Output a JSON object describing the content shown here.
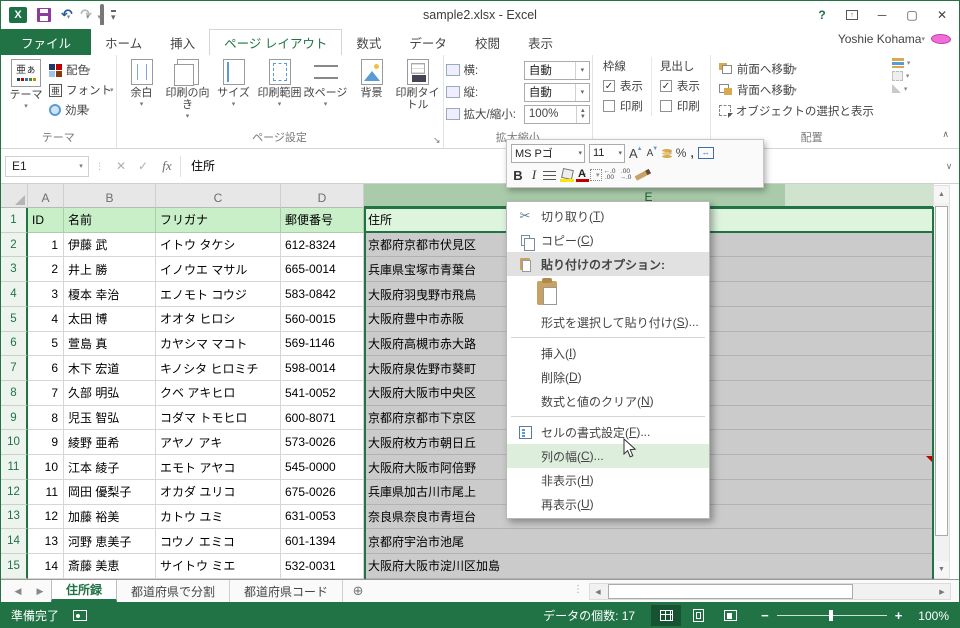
{
  "colors": {
    "accent": "#217346",
    "header_fill": "#c9efc9",
    "selection_grey": "#cbcbcb",
    "selected_col_header": "#a9cba9",
    "comment_red": "#c00000",
    "status_bar": "#217346"
  },
  "titlebar": {
    "title": "sample2.xlsx - Excel",
    "user": "Yoshie Kohama",
    "help": "?"
  },
  "ribbon_tabs": {
    "file": "ファイル",
    "items": [
      "ホーム",
      "挿入",
      "ページ レイアウト",
      "数式",
      "データ",
      "校閲",
      "表示"
    ],
    "active": "ページ レイアウト"
  },
  "ribbon": {
    "themes": {
      "main": "テーマ",
      "glyph": "亜ぁ",
      "glyph_small": "亜",
      "color": "配色",
      "font": "フォント",
      "effect": "効果",
      "label": "テーマ"
    },
    "page_setup": {
      "buttons": [
        "余白",
        "印刷の向き",
        "サイズ",
        "印刷範囲",
        "改ページ",
        "背景",
        "印刷タイトル"
      ],
      "label": "ページ設定"
    },
    "scale": {
      "width_label": "横:",
      "width_value": "自動",
      "height_label": "縦:",
      "height_value": "自動",
      "zoom_label": "拡大/縮小:",
      "zoom_value": "100%",
      "label": "拡大縮小"
    },
    "sheet_options": {
      "gridlines": "枠線",
      "headings": "見出し",
      "view": "表示",
      "print": "印刷"
    },
    "arrange": {
      "bring_front": "前面へ移動",
      "send_back": "背面へ移動",
      "selection_pane": "オブジェクトの選択と表示",
      "label": "配置"
    }
  },
  "mini_toolbar": {
    "font": "MS Pゴ",
    "size": "11",
    "bold": "B",
    "italic": "I",
    "percent": "%",
    "comma": ","
  },
  "formula_bar": {
    "name_box": "E1",
    "value": "住所",
    "fx": "fx"
  },
  "grid": {
    "col_letters": [
      "A",
      "B",
      "C",
      "D",
      "E"
    ],
    "header_row": {
      "n": "1",
      "id": "ID",
      "name": "名前",
      "kana": "フリガナ",
      "zip": "郵便番号",
      "addr": "住所"
    },
    "rows": [
      {
        "n": "2",
        "id": "1",
        "name": "伊藤 武",
        "kana": "イトウ タケシ",
        "zip": "612-8324",
        "addr": "京都府京都市伏見区"
      },
      {
        "n": "3",
        "id": "2",
        "name": "井上 勝",
        "kana": "イノウエ マサル",
        "zip": "665-0014",
        "addr": "兵庫県宝塚市青葉台"
      },
      {
        "n": "4",
        "id": "3",
        "name": "榎本 幸治",
        "kana": "エノモト コウジ",
        "zip": "583-0842",
        "addr": "大阪府羽曳野市飛鳥"
      },
      {
        "n": "5",
        "id": "4",
        "name": "太田 博",
        "kana": "オオタ ヒロシ",
        "zip": "560-0015",
        "addr": "大阪府豊中市赤阪"
      },
      {
        "n": "6",
        "id": "5",
        "name": "萱島 真",
        "kana": "カヤシマ マコト",
        "zip": "569-1146",
        "addr": "大阪府高槻市赤大路"
      },
      {
        "n": "7",
        "id": "6",
        "name": "木下 宏道",
        "kana": "キノシタ ヒロミチ",
        "zip": "598-0014",
        "addr": "大阪府泉佐野市葵町"
      },
      {
        "n": "8",
        "id": "7",
        "name": "久部 明弘",
        "kana": "クベ アキヒロ",
        "zip": "541-0052",
        "addr": "大阪府大阪市中央区"
      },
      {
        "n": "9",
        "id": "8",
        "name": "児玉 智弘",
        "kana": "コダマ トモヒロ",
        "zip": "600-8071",
        "addr": "京都府京都市下京区"
      },
      {
        "n": "10",
        "id": "9",
        "name": "綾野 亜希",
        "kana": "アヤノ アキ",
        "zip": "573-0026",
        "addr": "大阪府枚方市朝日丘"
      },
      {
        "n": "11",
        "id": "10",
        "name": "江本 綾子",
        "kana": "エモト アヤコ",
        "zip": "545-0000",
        "addr": "大阪府大阪市阿倍野",
        "flags": [
          "has-comment"
        ]
      },
      {
        "n": "12",
        "id": "11",
        "name": "岡田 優梨子",
        "kana": "オカダ ユリコ",
        "zip": "675-0026",
        "addr": "兵庫県加古川市尾上"
      },
      {
        "n": "13",
        "id": "12",
        "name": "加藤 裕美",
        "kana": "カトウ ユミ",
        "zip": "631-0053",
        "addr": "奈良県奈良市青垣台"
      },
      {
        "n": "14",
        "id": "13",
        "name": "河野 恵美子",
        "kana": "コウノ エミコ",
        "zip": "601-1394",
        "addr": "京都府宇治市池尾"
      },
      {
        "n": "15",
        "id": "14",
        "name": "斎藤 美恵",
        "kana": "サイトウ ミエ",
        "zip": "532-0031",
        "addr": "大阪府大阪市淀川区加島"
      }
    ]
  },
  "context_menu": {
    "items": {
      "cut": {
        "pre": "切り取り(",
        "key": "T",
        "post": ")"
      },
      "copy": {
        "pre": "コピー(",
        "key": "C",
        "post": ")"
      },
      "paste_options": {
        "pre": "貼り付けのオプション:",
        "key": "",
        "post": ""
      },
      "paste_special": {
        "pre": "形式を選択して貼り付け(",
        "key": "S",
        "post": ")..."
      },
      "insert": {
        "pre": "挿入(",
        "key": "I",
        "post": ")"
      },
      "delete": {
        "pre": "削除(",
        "key": "D",
        "post": ")"
      },
      "clear": {
        "pre": "数式と値のクリア(",
        "key": "N",
        "post": ")"
      },
      "format_cells": {
        "pre": "セルの書式設定(",
        "key": "F",
        "post": ")..."
      },
      "column_width": {
        "pre": "列の幅(",
        "key": "C",
        "post": ")..."
      },
      "hide": {
        "pre": "非表示(",
        "key": "H",
        "post": ")"
      },
      "unhide": {
        "pre": "再表示(",
        "key": "U",
        "post": ")"
      }
    }
  },
  "sheet_tabs": {
    "tabs": [
      "住所録",
      "都道府県で分割",
      "都道府県コード"
    ],
    "active": "住所録"
  },
  "status_bar": {
    "mode": "準備完了",
    "count": "データの個数: 17",
    "zoom": "100%",
    "minus": "−",
    "plus": "+"
  }
}
